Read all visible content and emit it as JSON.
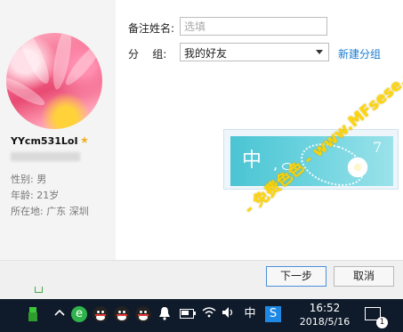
{
  "profile": {
    "username": "YYcm531LoI",
    "star_icon": "star-icon",
    "info": {
      "gender_label": "性别:",
      "gender_value": "男",
      "age_label": "年龄:",
      "age_value": "21岁",
      "location_label": "所在地:",
      "location_value": "广东  深圳"
    }
  },
  "form": {
    "remark_label": "备注姓名:",
    "remark_placeholder": "选填",
    "group_label": "分    组:",
    "group_value": "我的好友",
    "new_group_link": "新建分组"
  },
  "ad": {
    "text": "中",
    "comma": ",",
    "number": "7"
  },
  "buttons": {
    "next": "下一步",
    "cancel": "取消"
  },
  "watermark": {
    "text": "- 免费色色 - www.MFsese.com"
  },
  "taskbar": {
    "ime": "中",
    "time": "16:52",
    "date": "2018/5/16",
    "notification_count": "1",
    "battery_level": 0.7
  },
  "colors": {
    "link": "#1a7bd1",
    "star": "#f2b01e",
    "watermark": "#ffd400",
    "taskbar": "#0f1a2a"
  }
}
